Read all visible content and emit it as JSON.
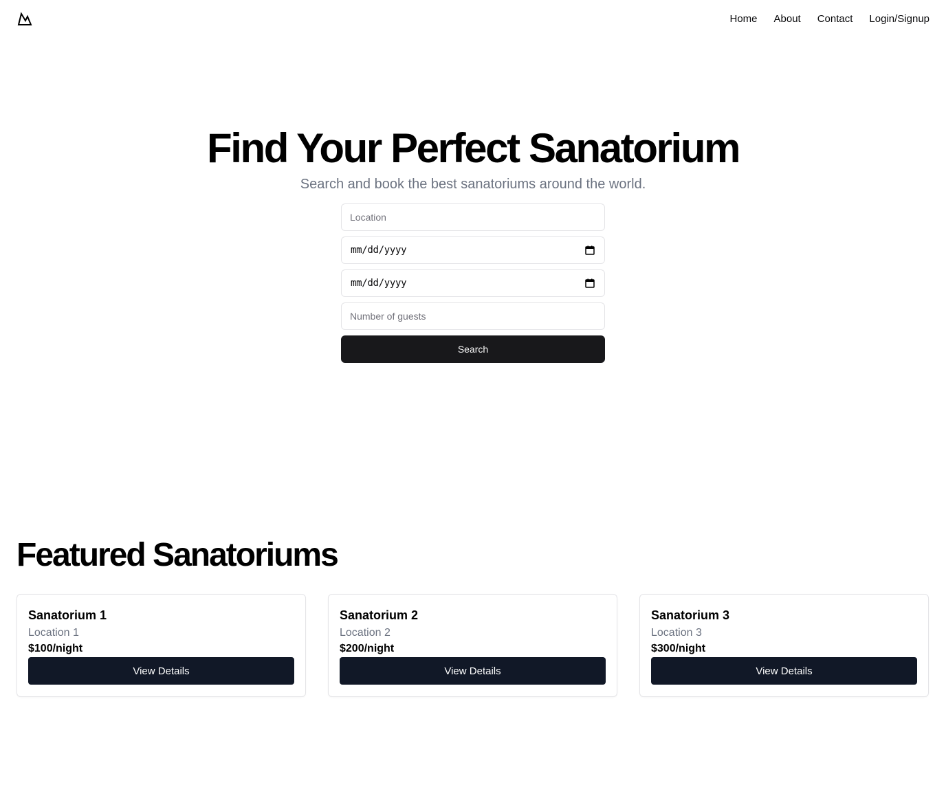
{
  "header": {
    "logo_icon": "mountain-icon",
    "nav": [
      {
        "label": "Home"
      },
      {
        "label": "About"
      },
      {
        "label": "Contact"
      },
      {
        "label": "Login/Signup"
      }
    ]
  },
  "hero": {
    "title": "Find Your Perfect Sanatorium",
    "subtitle": "Search and book the best sanatoriums around the world."
  },
  "search": {
    "location_placeholder": "Location",
    "checkin_value": "mm/dd/yyyy",
    "checkout_value": "mm/dd/yyyy",
    "guests_placeholder": "Number of guests",
    "button_label": "Search",
    "calendar_icon": "calendar-icon"
  },
  "featured": {
    "title": "Featured Sanatoriums",
    "cards": [
      {
        "name": "Sanatorium 1",
        "location": "Location 1",
        "price": "$100/night",
        "button": "View Details"
      },
      {
        "name": "Sanatorium 2",
        "location": "Location 2",
        "price": "$200/night",
        "button": "View Details"
      },
      {
        "name": "Sanatorium 3",
        "location": "Location 3",
        "price": "$300/night",
        "button": "View Details"
      }
    ]
  },
  "colors": {
    "primary_button": "#18181b",
    "card_button": "#111827",
    "muted_text": "#6b7280",
    "border": "#e4e4e7"
  }
}
